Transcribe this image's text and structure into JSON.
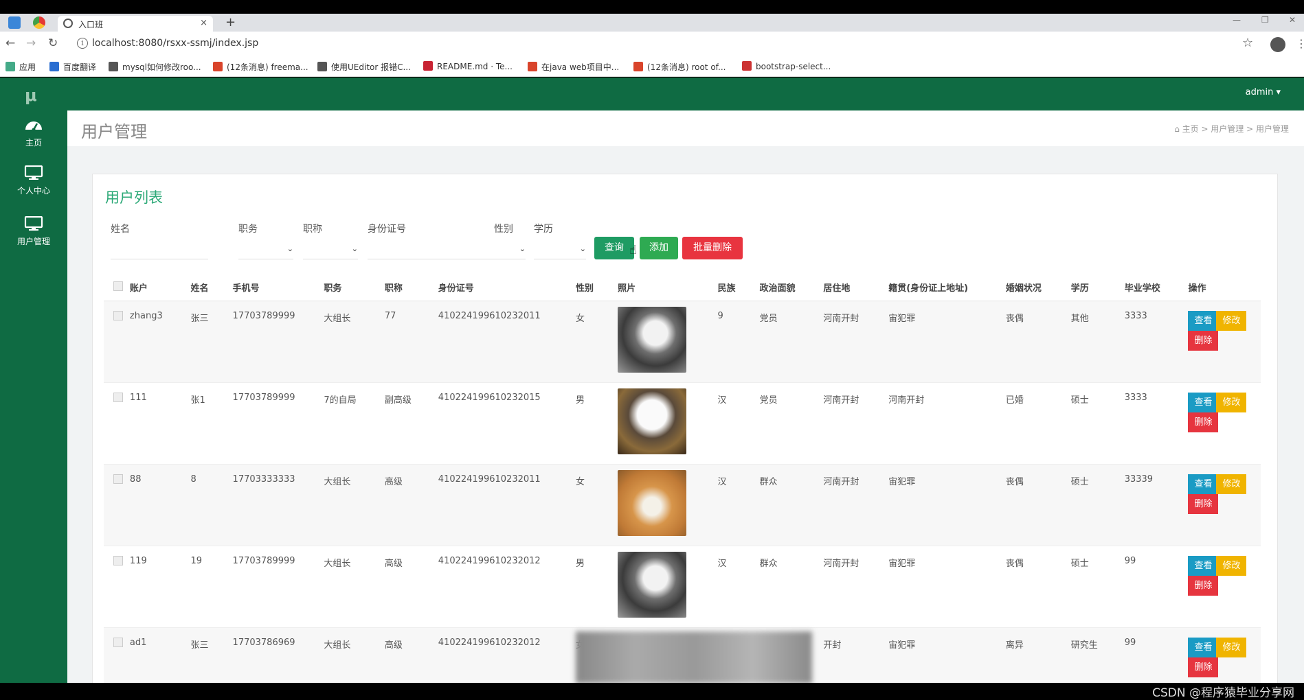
{
  "browser": {
    "tab_title": "入口班",
    "tab_close": "×",
    "new_tab": "+",
    "url": "localhost:8080/rsxx-ssmj/index.jsp",
    "bookmarks": [
      {
        "label": "应用",
        "color": "#4a8"
      },
      {
        "label": "百度翻译",
        "color": "#2a6ed1"
      },
      {
        "label": "mysql如何修改roo...",
        "color": "#555"
      },
      {
        "label": "(12条消息) freema...",
        "color": "#d9442b"
      },
      {
        "label": "使用UEditor 报错C...",
        "color": "#555"
      },
      {
        "label": "README.md · Te...",
        "color": "#c82333"
      },
      {
        "label": "在java web项目中...",
        "color": "#d9442b"
      },
      {
        "label": "(12条消息) root of...",
        "color": "#d9442b"
      },
      {
        "label": "bootstrap-select...",
        "color": "#c33"
      }
    ]
  },
  "app": {
    "logo": "μ",
    "user": "admin ▾",
    "sidebar": [
      {
        "label": "主页",
        "icon": "dashboard-icon"
      },
      {
        "label": "个人中心",
        "icon": "monitor-icon"
      },
      {
        "label": "用户管理",
        "icon": "monitor-icon"
      }
    ],
    "page_title": "用户管理",
    "breadcrumb": "主页 > 用户管理 > 用户管理",
    "panel_title": "用户列表",
    "filters": {
      "name": "姓名",
      "duty": "职务",
      "title": "职称",
      "idcard": "身份证号",
      "gender": "性别",
      "education": "学历"
    },
    "buttons": {
      "query": "查询",
      "add": "添加",
      "bulk_delete": "批量删除"
    },
    "table": {
      "headers": [
        "账户",
        "姓名",
        "手机号",
        "职务",
        "职称",
        "身份证号",
        "性别",
        "照片",
        "民族",
        "政治面貌",
        "居住地",
        "籍贯(身份证上地址)",
        "婚姻状况",
        "学历",
        "毕业学校",
        "操作"
      ],
      "rows": [
        {
          "account": "zhang3",
          "name": "张三",
          "phone": "17703789999",
          "duty": "大组长",
          "title": "77",
          "idcard": "410224199610232011",
          "gender": "女",
          "photo": "husky",
          "ethnicity": "9",
          "politics": "党员",
          "residence": "河南开封",
          "origin": "宙犯罪",
          "marital": "丧偶",
          "education": "其他",
          "school": "3333"
        },
        {
          "account": "111",
          "name": "张1",
          "phone": "17703789999",
          "duty": "7的自局",
          "title": "副高级",
          "idcard": "410224199610232015",
          "gender": "男",
          "photo": "cat",
          "ethnicity": "汉",
          "politics": "党员",
          "residence": "河南开封",
          "origin": "河南开封",
          "marital": "已婚",
          "education": "硕士",
          "school": "3333"
        },
        {
          "account": "88",
          "name": "8",
          "phone": "17703333333",
          "duty": "大组长",
          "title": "高级",
          "idcard": "410224199610232011",
          "gender": "女",
          "photo": "shiba",
          "ethnicity": "汉",
          "politics": "群众",
          "residence": "河南开封",
          "origin": "宙犯罪",
          "marital": "丧偶",
          "education": "硕士",
          "school": "33339"
        },
        {
          "account": "119",
          "name": "19",
          "phone": "17703789999",
          "duty": "大组长",
          "title": "高级",
          "idcard": "410224199610232012",
          "gender": "男",
          "photo": "husky",
          "ethnicity": "汉",
          "politics": "群众",
          "residence": "河南开封",
          "origin": "宙犯罪",
          "marital": "丧偶",
          "education": "硕士",
          "school": "99"
        },
        {
          "account": "ad1",
          "name": "张三",
          "phone": "17703786969",
          "duty": "大组长",
          "title": "高级",
          "idcard": "410224199610232012",
          "gender": "女",
          "photo": "",
          "ethnicity": "",
          "politics": "",
          "residence": "开封",
          "origin": "宙犯罪",
          "marital": "离异",
          "education": "研究生",
          "school": "99"
        }
      ],
      "actions": {
        "view": "查看",
        "edit": "修改",
        "delete": "删除"
      }
    }
  },
  "watermark": "CSDN @程序猿毕业分享网"
}
